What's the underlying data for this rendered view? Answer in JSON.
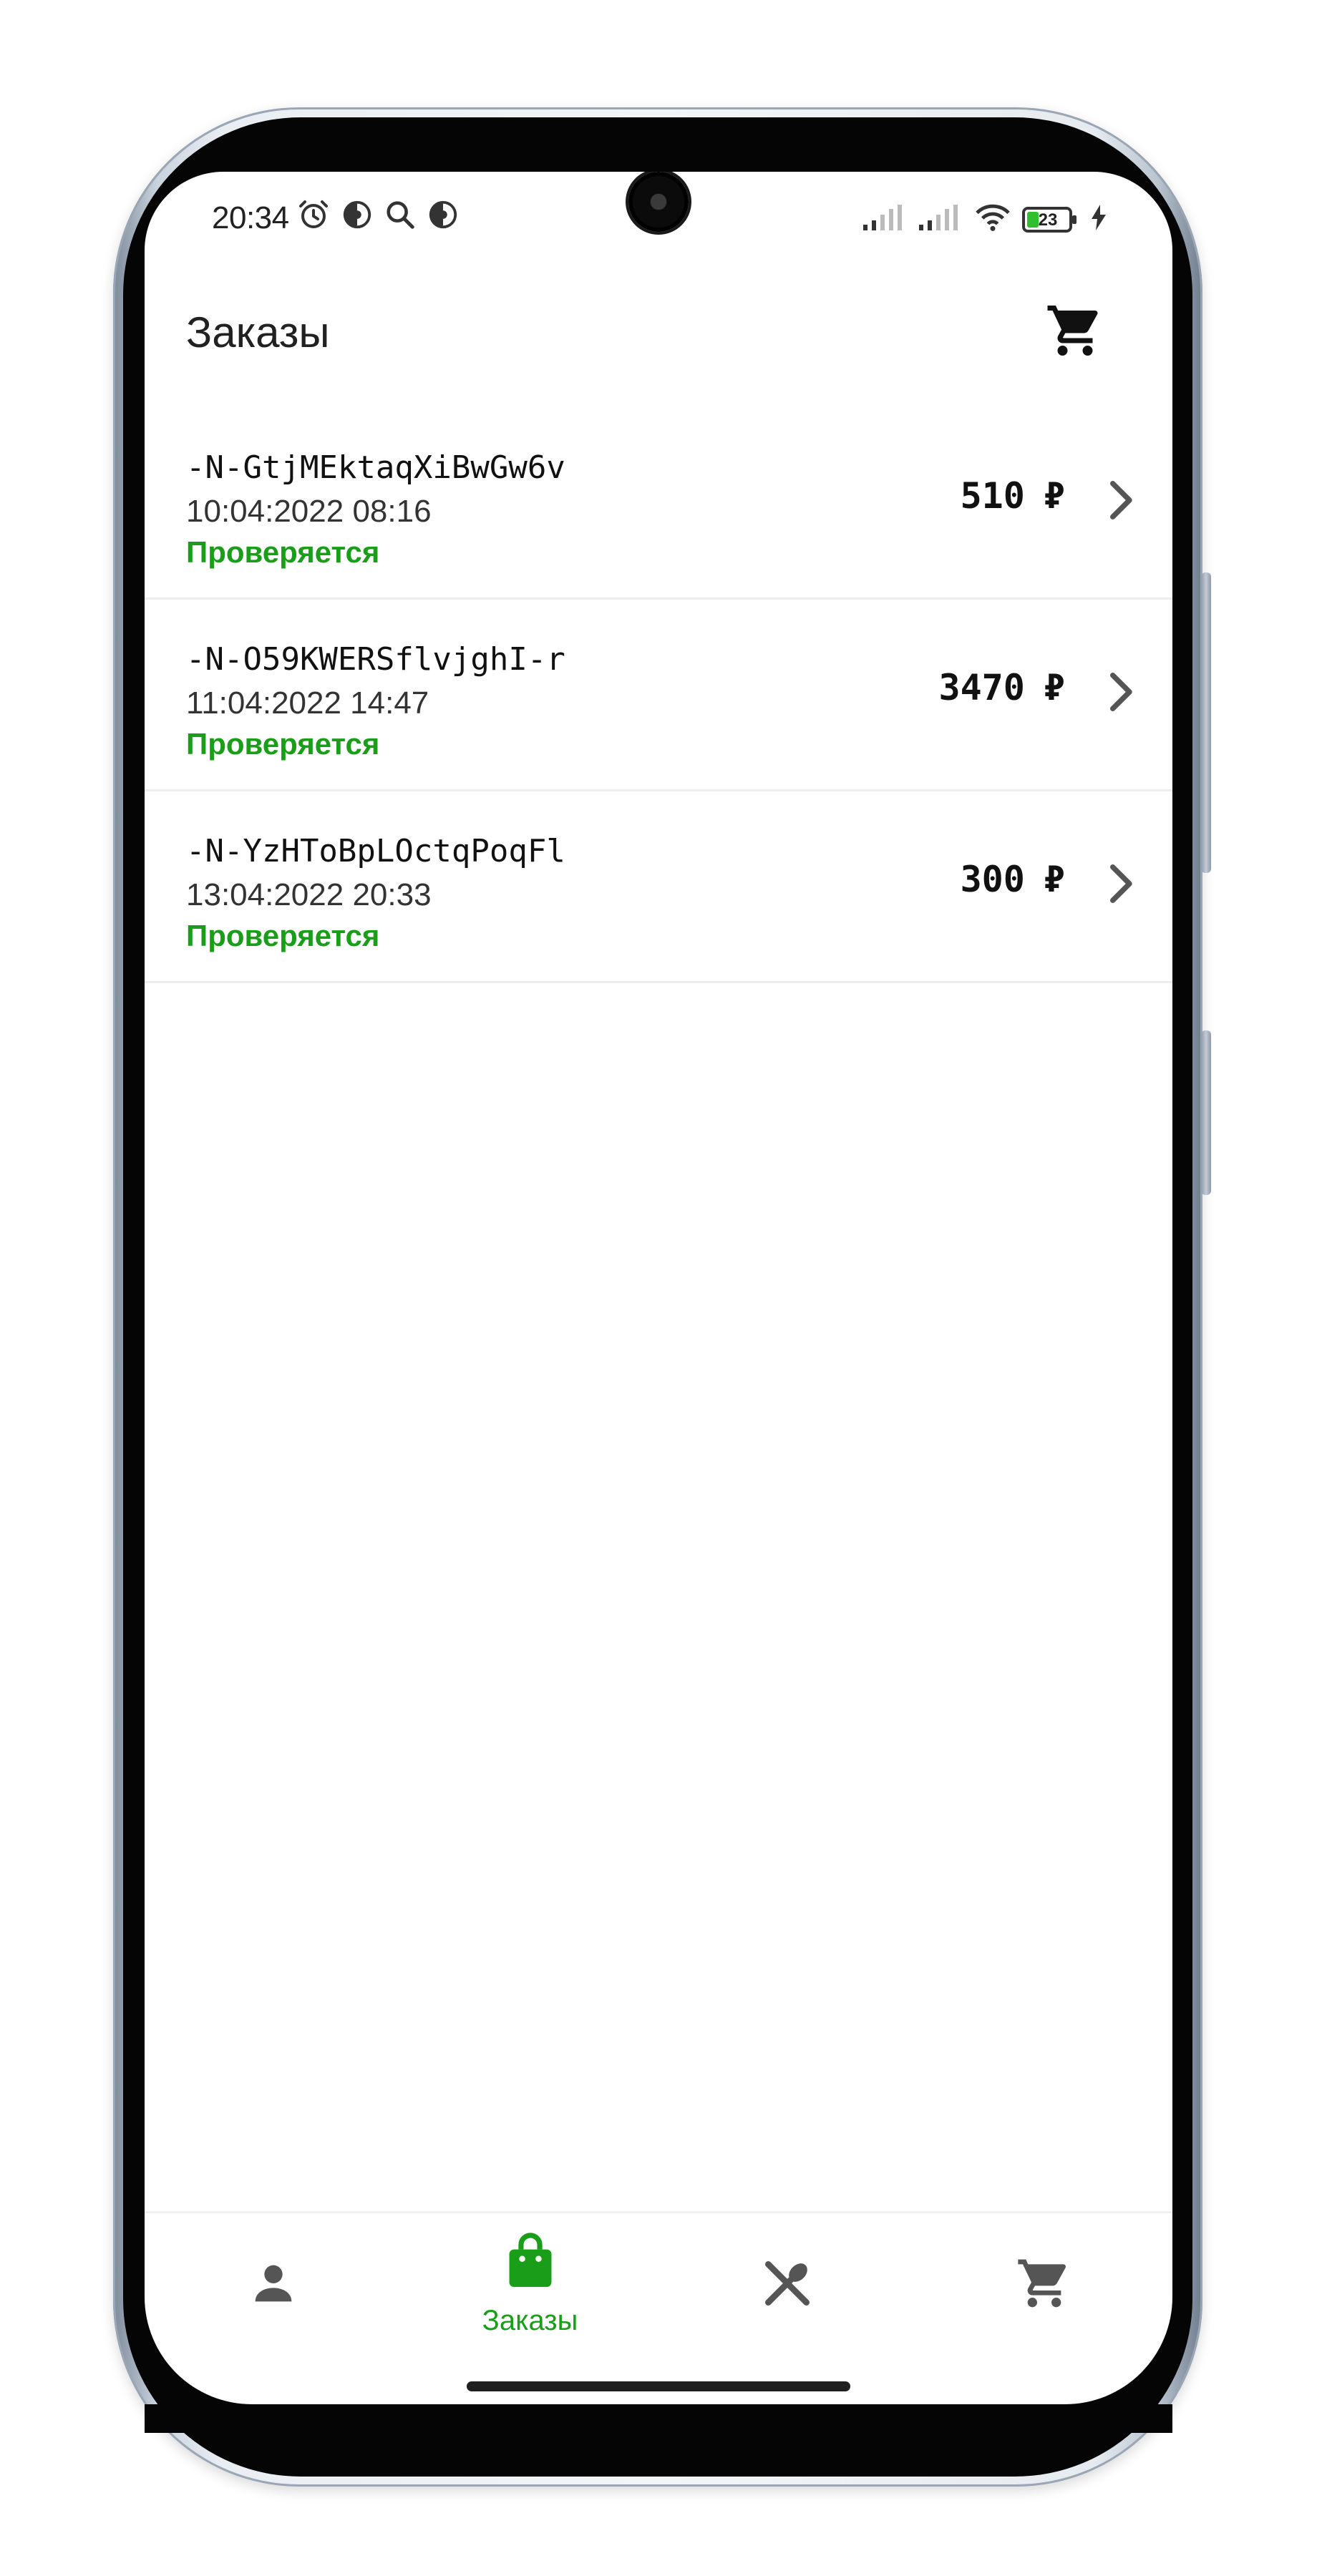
{
  "status_bar": {
    "time": "20:34",
    "battery_level": "23"
  },
  "app_bar": {
    "title": "Заказы"
  },
  "orders": [
    {
      "id": "-N-GtjMEktaqXiBwGw6v",
      "date": "10:04:2022 08:16",
      "status": "Проверяется",
      "price": "510",
      "currency": "₽"
    },
    {
      "id": "-N-O59KWERSflvjghI-r",
      "date": "11:04:2022 14:47",
      "status": "Проверяется",
      "price": "3470",
      "currency": "₽"
    },
    {
      "id": "-N-YzHToBpLOctqPoqFl",
      "date": "13:04:2022 20:33",
      "status": "Проверяется",
      "price": "300",
      "currency": "₽"
    }
  ],
  "bottom_nav": {
    "items": [
      {
        "icon": "person-icon",
        "label": ""
      },
      {
        "icon": "shopping-bag-icon",
        "label": "Заказы"
      },
      {
        "icon": "utensils-icon",
        "label": ""
      },
      {
        "icon": "cart-icon",
        "label": ""
      }
    ]
  },
  "colors": {
    "accent_green": "#1a9e1a",
    "text_dark": "#212121",
    "icon_grey": "#555555"
  }
}
